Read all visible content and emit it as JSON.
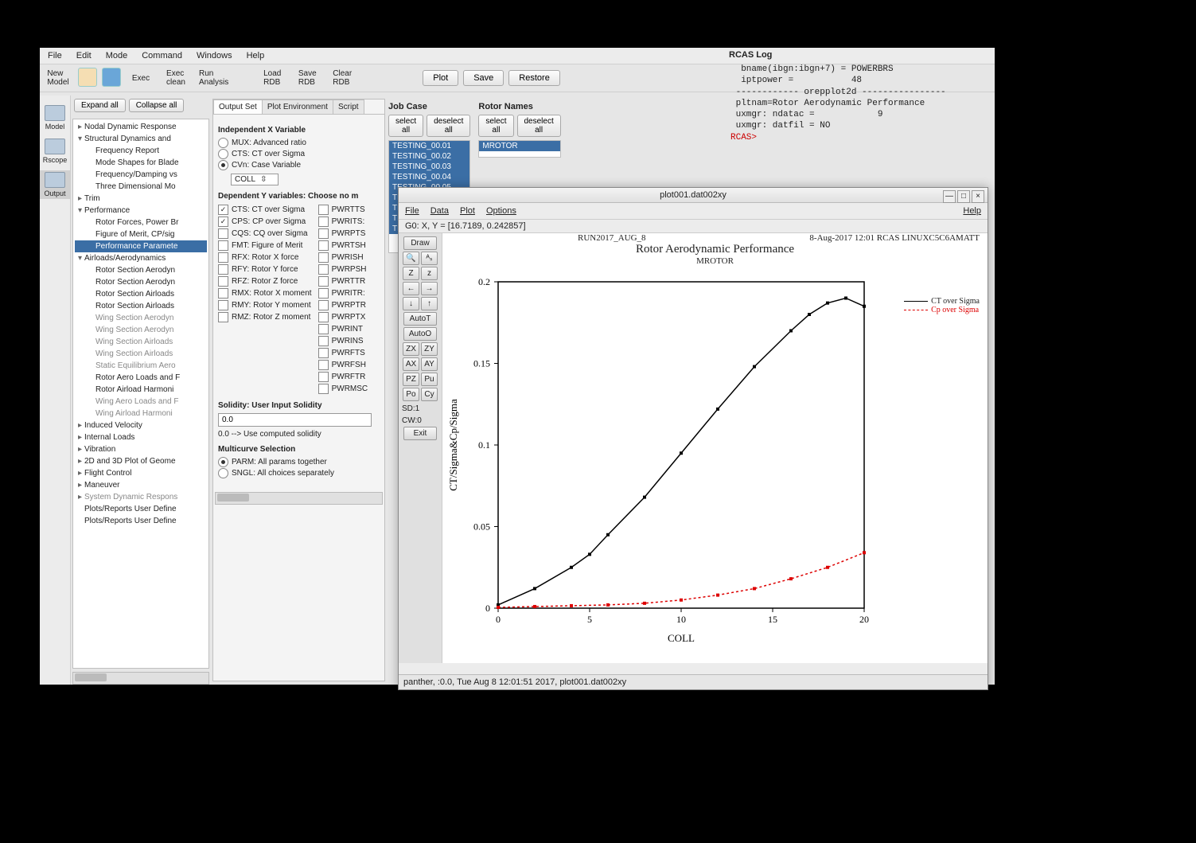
{
  "menubar": [
    "File",
    "Edit",
    "Mode",
    "Command",
    "Windows",
    "Help"
  ],
  "toolbar": {
    "new_model": "New\nModel",
    "exec": "Exec",
    "exec_clean": "Exec\nclean",
    "run_analysis": "Run\nAnalysis",
    "load_rdb": "Load\nRDB",
    "save_rdb": "Save\nRDB",
    "clear_rdb": "Clear\nRDB"
  },
  "action_buttons": {
    "plot": "Plot",
    "save": "Save",
    "restore": "Restore"
  },
  "tree_buttons": {
    "expand": "Expand all",
    "collapse": "Collapse all"
  },
  "sidebar": [
    {
      "label": "Model"
    },
    {
      "label": "Rscope"
    },
    {
      "label": "Output",
      "selected": true
    }
  ],
  "tree": [
    {
      "t": "Nodal Dynamic Response",
      "lvl": 0,
      "caret": "▸"
    },
    {
      "t": "Structural Dynamics and",
      "lvl": 0,
      "caret": "▾"
    },
    {
      "t": "Frequency Report",
      "lvl": 1
    },
    {
      "t": "Mode Shapes for Blade",
      "lvl": 1
    },
    {
      "t": "Frequency/Damping vs",
      "lvl": 1
    },
    {
      "t": "Three Dimensional Mo",
      "lvl": 1
    },
    {
      "t": "Trim",
      "lvl": 0,
      "caret": "▸"
    },
    {
      "t": "Performance",
      "lvl": 0,
      "caret": "▾"
    },
    {
      "t": "Rotor Forces, Power Br",
      "lvl": 1
    },
    {
      "t": "Figure of Merit, CP/sig",
      "lvl": 1
    },
    {
      "t": "Performance Paramete",
      "lvl": 1,
      "sel": true
    },
    {
      "t": "Airloads/Aerodynamics",
      "lvl": 0,
      "caret": "▾"
    },
    {
      "t": "Rotor Section Aerodyn",
      "lvl": 1
    },
    {
      "t": "Rotor Section Aerodyn",
      "lvl": 1
    },
    {
      "t": "Rotor Section Airloads",
      "lvl": 1
    },
    {
      "t": "Rotor Section Airloads",
      "lvl": 1
    },
    {
      "t": "Wing Section Aerodyn",
      "lvl": 1,
      "dim": true
    },
    {
      "t": "Wing Section Aerodyn",
      "lvl": 1,
      "dim": true
    },
    {
      "t": "Wing Section Airloads",
      "lvl": 1,
      "dim": true
    },
    {
      "t": "Wing Section Airloads",
      "lvl": 1,
      "dim": true
    },
    {
      "t": "Static Equilibrium Aero",
      "lvl": 1,
      "dim": true
    },
    {
      "t": "Rotor Aero Loads and F",
      "lvl": 1
    },
    {
      "t": "Rotor Airload Harmoni",
      "lvl": 1
    },
    {
      "t": "Wing Aero Loads and F",
      "lvl": 1,
      "dim": true
    },
    {
      "t": "Wing Airload Harmoni",
      "lvl": 1,
      "dim": true
    },
    {
      "t": "Induced Velocity",
      "lvl": 0,
      "caret": "▸"
    },
    {
      "t": "Internal Loads",
      "lvl": 0,
      "caret": "▸"
    },
    {
      "t": "Vibration",
      "lvl": 0,
      "caret": "▸"
    },
    {
      "t": "2D and 3D Plot of Geome",
      "lvl": 0,
      "caret": "▸"
    },
    {
      "t": "Flight Control",
      "lvl": 0,
      "caret": "▸"
    },
    {
      "t": "Maneuver",
      "lvl": 0,
      "caret": "▸"
    },
    {
      "t": "System Dynamic Respons",
      "lvl": 0,
      "caret": "▸",
      "dim": true
    },
    {
      "t": "Plots/Reports User Define",
      "lvl": 0
    },
    {
      "t": "Plots/Reports User Define",
      "lvl": 0
    }
  ],
  "tabs": [
    "Output Set",
    "Plot Environment",
    "Script"
  ],
  "xvar": {
    "title": "Independent X Variable",
    "options": [
      {
        "label": "MUX: Advanced ratio",
        "on": false
      },
      {
        "label": "CTS: CT over Sigma",
        "on": false
      },
      {
        "label": "CVn: Case Variable",
        "on": true
      }
    ],
    "select": "COLL"
  },
  "yvar": {
    "title": "Dependent Y variables: Choose no m",
    "col1": [
      {
        "label": "CTS: CT over Sigma",
        "on": true
      },
      {
        "label": "CPS: CP over Sigma",
        "on": true
      },
      {
        "label": "CQS: CQ over Sigma",
        "on": false
      },
      {
        "label": "FMT: Figure of Merit",
        "on": false
      },
      {
        "label": "RFX: Rotor X force",
        "on": false
      },
      {
        "label": "RFY: Rotor Y force",
        "on": false
      },
      {
        "label": "RFZ: Rotor Z force",
        "on": false
      },
      {
        "label": "RMX: Rotor X moment",
        "on": false
      },
      {
        "label": "RMY: Rotor Y moment",
        "on": false
      },
      {
        "label": "RMZ: Rotor Z moment",
        "on": false
      }
    ],
    "col2": [
      {
        "label": "PWRTTS"
      },
      {
        "label": "PWRITS:"
      },
      {
        "label": "PWRPTS"
      },
      {
        "label": "PWRTSH"
      },
      {
        "label": "PWRISH"
      },
      {
        "label": "PWRPSH"
      },
      {
        "label": "PWRTTR"
      },
      {
        "label": "PWRITR:"
      },
      {
        "label": "PWRPTR"
      },
      {
        "label": "PWRPTX"
      },
      {
        "label": "PWRINT"
      },
      {
        "label": "PWRINS"
      },
      {
        "label": "PWRFTS"
      },
      {
        "label": "PWRFSH"
      },
      {
        "label": "PWRFTR"
      },
      {
        "label": "PWRMSC"
      }
    ]
  },
  "solidity": {
    "title": "Solidity: User Input Solidity",
    "value": "0.0",
    "note": "0.0 --> Use computed solidity"
  },
  "multicurve": {
    "title": "Multicurve Selection",
    "options": [
      {
        "label": "PARM: All params together",
        "on": true
      },
      {
        "label": "SNGL: All choices separately",
        "on": false
      }
    ]
  },
  "jobcase": {
    "title": "Job Case",
    "select_all": "select all",
    "deselect_all": "deselect all",
    "items": [
      "TESTING_00.01",
      "TESTING_00.02",
      "TESTING_00.03",
      "TESTING_00.04",
      "TESTING_00.05",
      "TESTING_00.06",
      "TESTING_00.07",
      "TESTING_00.08",
      "TESTING_00.09"
    ]
  },
  "rotornames": {
    "title": "Rotor Names",
    "select_all": "select all",
    "deselect_all": "deselect all",
    "items": [
      "MROTOR"
    ]
  },
  "log": {
    "title": "RCAS Log",
    "lines": [
      "  bname(ibgn:ibgn+7) = POWERBRS",
      "  iptpower =           48",
      " ------------ orepplot2d ----------------",
      " pltnam=Rotor Aerodynamic Performance",
      " uxmgr: ndatac =            9",
      " uxmgr: datfil = NO"
    ],
    "prompt": "RCAS>"
  },
  "plot_window": {
    "title": "plot001.dat002xy",
    "menu": [
      "File",
      "Data",
      "Plot",
      "Options"
    ],
    "help": "Help",
    "info": "G0: X, Y = [16.7189, 0.242857]",
    "tools_top": "Draw",
    "tool_rows": [
      [
        "🔍",
        "ᴬₛ"
      ],
      [
        "Z",
        "z"
      ],
      [
        "←",
        "→"
      ],
      [
        "↓",
        "↑"
      ]
    ],
    "tool_btns": [
      "AutoT",
      "AutoO"
    ],
    "tool_pairs": [
      [
        "ZX",
        "ZY"
      ],
      [
        "AX",
        "AY"
      ],
      [
        "PZ",
        "Pu"
      ],
      [
        "Po",
        "Cy"
      ]
    ],
    "tool_txts": [
      "SD:1",
      "CW:0"
    ],
    "tool_exit": "Exit",
    "run_label": "RUN2017_AUG_8",
    "date_label": "8-Aug-2017 12:01 RCAS LINUXC5C6AMATT",
    "chart_title": "Rotor Aerodynamic Performance",
    "chart_sub": "MROTOR",
    "legend": [
      {
        "label": "CT over Sigma",
        "color": "black"
      },
      {
        "label": "Cp over Sigma",
        "color": "red"
      }
    ],
    "ylabel": "CT/Sigma&Cp/Sigma",
    "xlabel": "COLL",
    "status": "panther, :0.0, Tue Aug  8 12:01:51 2017, plot001.dat002xy"
  },
  "chart_data": {
    "type": "line",
    "title": "Rotor Aerodynamic Performance",
    "subtitle": "MROTOR",
    "xlabel": "COLL",
    "ylabel": "CT/Sigma&Cp/Sigma",
    "xlim": [
      0,
      20
    ],
    "ylim": [
      0,
      0.2
    ],
    "xticks": [
      0,
      5,
      10,
      15,
      20
    ],
    "yticks": [
      0,
      0.05,
      0.1,
      0.15,
      0.2
    ],
    "series": [
      {
        "name": "CT over Sigma",
        "color": "#000",
        "dash": false,
        "x": [
          0,
          2,
          4,
          5,
          6,
          8,
          10,
          12,
          14,
          16,
          17,
          18,
          19,
          20
        ],
        "y": [
          0.002,
          0.012,
          0.025,
          0.033,
          0.045,
          0.068,
          0.095,
          0.122,
          0.148,
          0.17,
          0.18,
          0.187,
          0.19,
          0.185
        ]
      },
      {
        "name": "Cp over Sigma",
        "color": "#d00",
        "dash": true,
        "x": [
          0,
          2,
          4,
          6,
          8,
          10,
          12,
          14,
          16,
          18,
          20
        ],
        "y": [
          0.0005,
          0.001,
          0.0015,
          0.002,
          0.003,
          0.005,
          0.008,
          0.012,
          0.018,
          0.025,
          0.034
        ]
      }
    ]
  }
}
